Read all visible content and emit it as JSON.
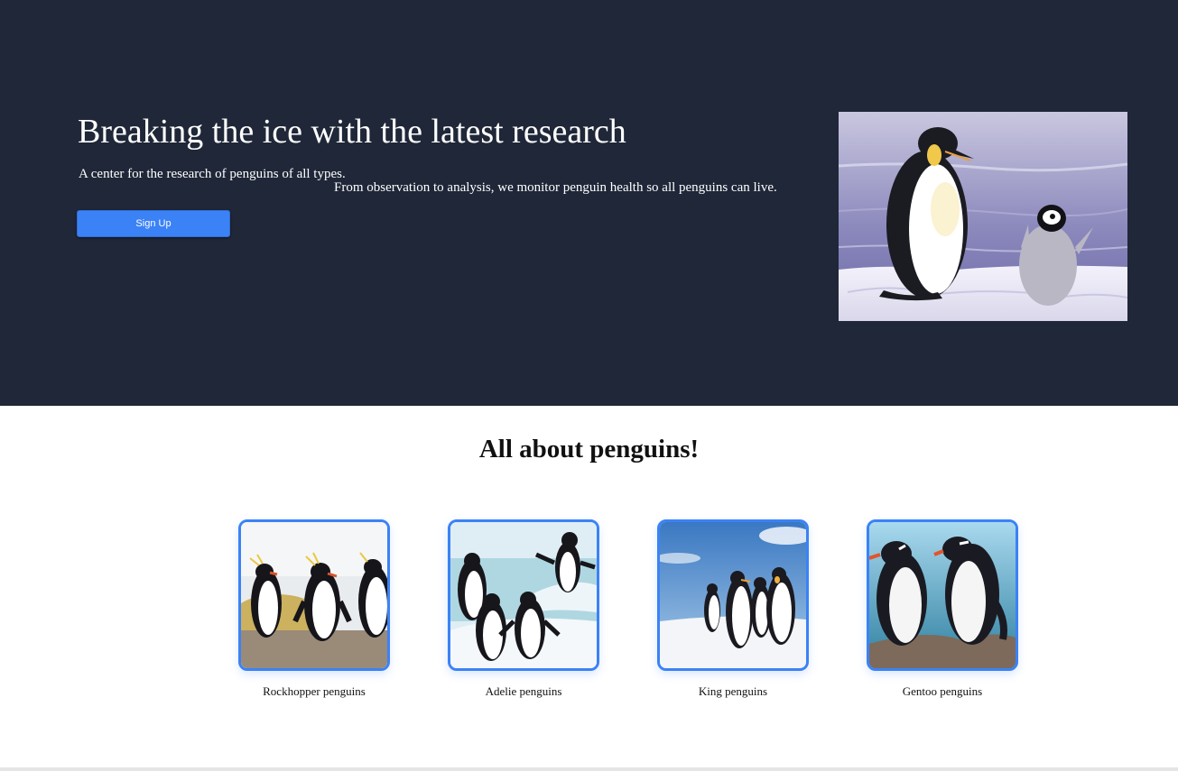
{
  "hero": {
    "title": "Breaking the ice with the latest research",
    "subtitle": "A center for the research of penguins of all types.",
    "description": "From observation to analysis, we monitor penguin health so all penguins can live.",
    "signup_label": "Sign Up",
    "image_alt": "emperor-penguin-adult-and-chick-photo"
  },
  "section": {
    "title": "All about penguins!"
  },
  "cards": [
    {
      "label": "Rockhopper penguins",
      "image": "rockhopper-penguins-photo"
    },
    {
      "label": "Adelie penguins",
      "image": "adelie-penguins-photo"
    },
    {
      "label": "King penguins",
      "image": "king-penguins-photo"
    },
    {
      "label": "Gentoo penguins",
      "image": "gentoo-penguins-photo"
    }
  ],
  "colors": {
    "hero_background": "#1f2738",
    "accent": "#3b82f6",
    "text_light": "#ffffff",
    "text_dark": "#111111"
  }
}
